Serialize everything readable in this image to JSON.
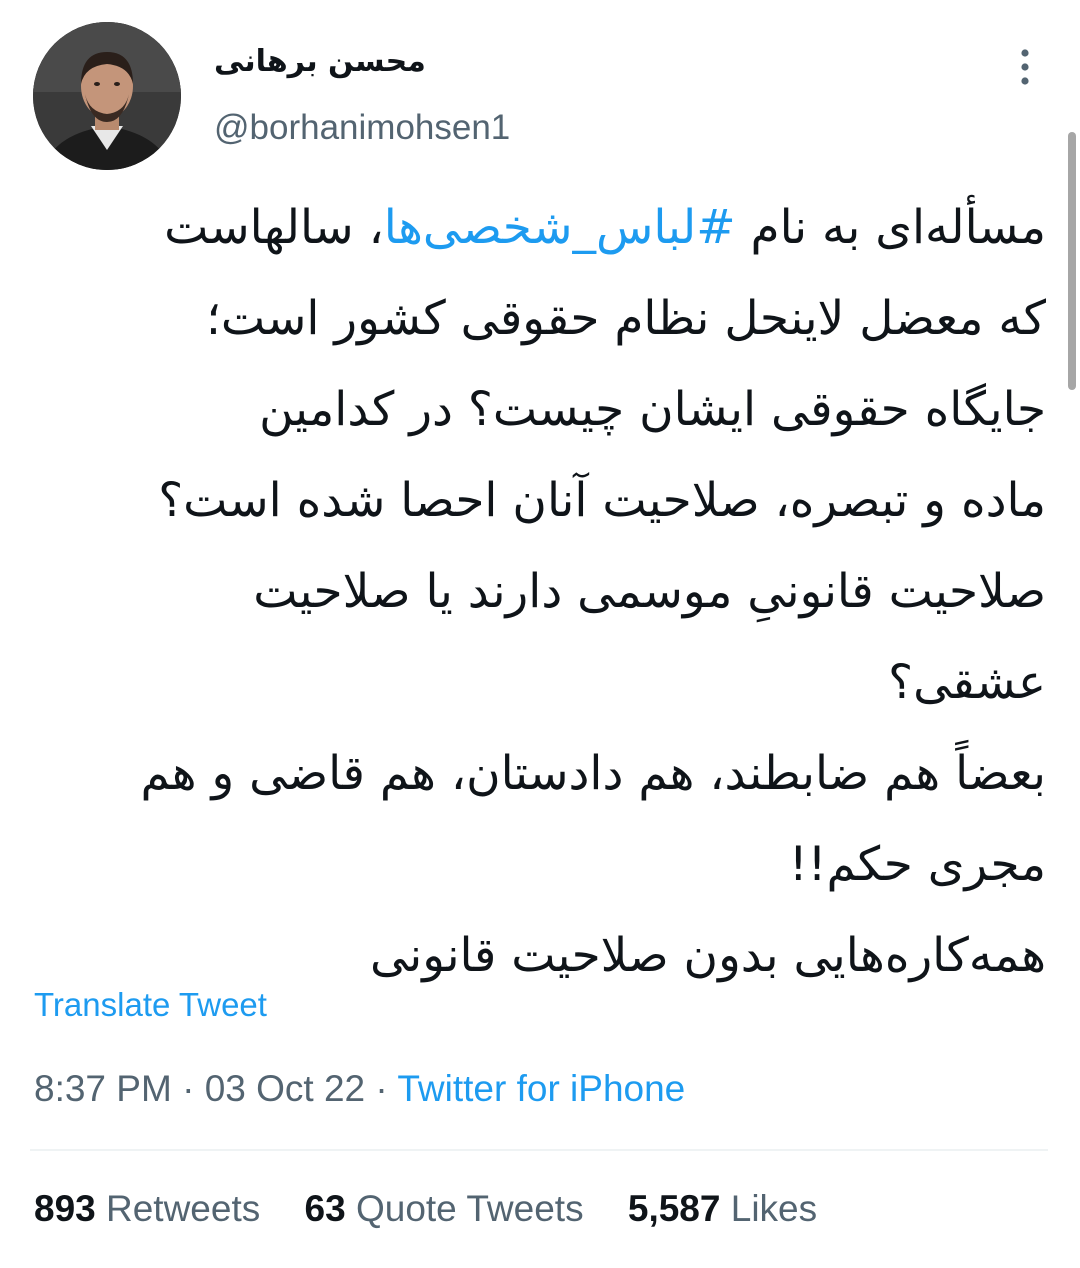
{
  "author": {
    "display_name": "محسن برهانی",
    "handle": "@borhanimohsen1"
  },
  "tweet": {
    "lines": [
      {
        "before": "مسأله‌ای به نام ",
        "hashtag": "#لباس_شخصی‌ها",
        "after": "، سالهاست"
      },
      {
        "text": "که معضل لاینحل نظام حقوقی کشور است؛"
      },
      {
        "text": "جایگاه حقوقی ایشان چیست؟ در کدامین"
      },
      {
        "text": "ماده و تبصره، صلاحیت آنان احصا شده است؟"
      },
      {
        "text": "صلاحیت قانونیِ موسمی دارند یا صلاحیت"
      },
      {
        "text": "عشقی؟"
      },
      {
        "text": "بعضاً هم ضابطند، هم دادستان، هم قاضی و هم"
      },
      {
        "text": "مجری حکم!!"
      },
      {
        "text": "همه‌کاره‌هایی بدون صلاحیت قانونی"
      }
    ],
    "translate_label": "Translate Tweet",
    "time": "8:37 PM",
    "separator": " · ",
    "date": "03 Oct 22",
    "source": "Twitter for iPhone"
  },
  "stats": {
    "retweets_count": "893",
    "retweets_label": " Retweets",
    "quotes_count": "63",
    "quotes_label": " Quote Tweets",
    "likes_count": "5,587",
    "likes_label": " Likes"
  },
  "icons": {
    "more": "vertical-ellipsis-icon"
  },
  "colors": {
    "accent": "#1d9bf0",
    "secondary_text": "#536471",
    "primary_text": "#0f1419",
    "divider": "#eff3f4"
  }
}
